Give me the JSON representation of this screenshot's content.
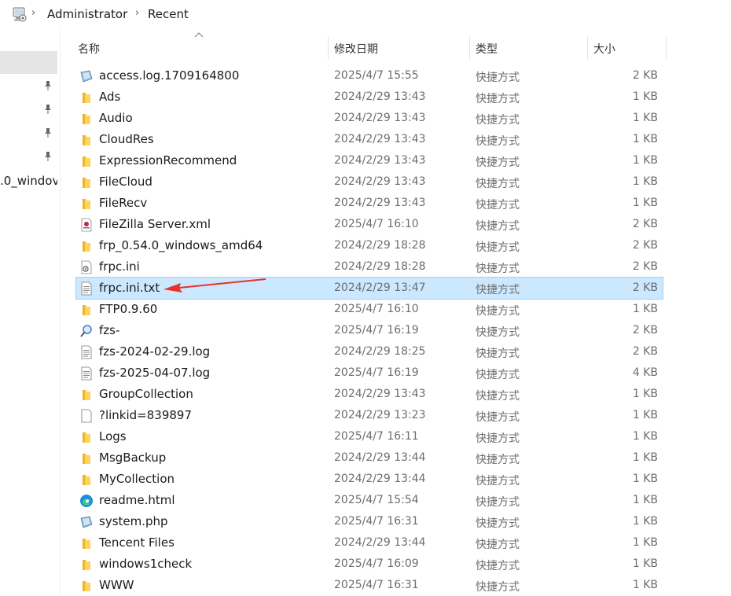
{
  "breadcrumb": {
    "items": [
      "Administrator",
      "Recent"
    ],
    "pc_icon": "computer-icon"
  },
  "nav": {
    "truncated_item": ".0_windov"
  },
  "columns": {
    "name": "名称",
    "date": "修改日期",
    "type": "类型",
    "size": "大小",
    "sort": "name-ascending"
  },
  "files": [
    {
      "name": "access.log.1709164800",
      "date": "2025/4/7 15:55",
      "type": "快捷方式",
      "size": "2 KB",
      "icon": "log-file-icon"
    },
    {
      "name": "Ads",
      "date": "2024/2/29 13:43",
      "type": "快捷方式",
      "size": "1 KB",
      "icon": "folder-icon"
    },
    {
      "name": "Audio",
      "date": "2024/2/29 13:43",
      "type": "快捷方式",
      "size": "1 KB",
      "icon": "folder-icon"
    },
    {
      "name": "CloudRes",
      "date": "2024/2/29 13:43",
      "type": "快捷方式",
      "size": "1 KB",
      "icon": "folder-icon"
    },
    {
      "name": "ExpressionRecommend",
      "date": "2024/2/29 13:43",
      "type": "快捷方式",
      "size": "1 KB",
      "icon": "folder-icon"
    },
    {
      "name": "FileCloud",
      "date": "2024/2/29 13:43",
      "type": "快捷方式",
      "size": "1 KB",
      "icon": "folder-icon"
    },
    {
      "name": "FileRecv",
      "date": "2024/2/29 13:43",
      "type": "快捷方式",
      "size": "1 KB",
      "icon": "folder-icon"
    },
    {
      "name": "FileZilla Server.xml",
      "date": "2025/4/7 16:10",
      "type": "快捷方式",
      "size": "2 KB",
      "icon": "xml-file-icon"
    },
    {
      "name": "frp_0.54.0_windows_amd64",
      "date": "2024/2/29 18:28",
      "type": "快捷方式",
      "size": "2 KB",
      "icon": "folder-icon"
    },
    {
      "name": "frpc.ini",
      "date": "2024/2/29 18:28",
      "type": "快捷方式",
      "size": "2 KB",
      "icon": "settings-file-icon"
    },
    {
      "name": "frpc.ini.txt",
      "date": "2024/2/29 13:47",
      "type": "快捷方式",
      "size": "2 KB",
      "icon": "text-file-icon",
      "selected": true
    },
    {
      "name": "FTP0.9.60",
      "date": "2025/4/7 16:10",
      "type": "快捷方式",
      "size": "1 KB",
      "icon": "folder-icon"
    },
    {
      "name": "fzs-",
      "date": "2025/4/7 16:19",
      "type": "快捷方式",
      "size": "2 KB",
      "icon": "search-icon"
    },
    {
      "name": "fzs-2024-02-29.log",
      "date": "2024/2/29 18:25",
      "type": "快捷方式",
      "size": "2 KB",
      "icon": "text-file-icon"
    },
    {
      "name": "fzs-2025-04-07.log",
      "date": "2025/4/7 16:19",
      "type": "快捷方式",
      "size": "4 KB",
      "icon": "text-file-icon"
    },
    {
      "name": "GroupCollection",
      "date": "2024/2/29 13:43",
      "type": "快捷方式",
      "size": "1 KB",
      "icon": "folder-icon"
    },
    {
      "name": "?linkid=839897",
      "date": "2024/2/29 13:23",
      "type": "快捷方式",
      "size": "1 KB",
      "icon": "blank-file-icon"
    },
    {
      "name": "Logs",
      "date": "2025/4/7 16:11",
      "type": "快捷方式",
      "size": "1 KB",
      "icon": "folder-icon"
    },
    {
      "name": "MsgBackup",
      "date": "2024/2/29 13:44",
      "type": "快捷方式",
      "size": "1 KB",
      "icon": "folder-icon"
    },
    {
      "name": "MyCollection",
      "date": "2024/2/29 13:44",
      "type": "快捷方式",
      "size": "1 KB",
      "icon": "folder-icon"
    },
    {
      "name": "readme.html",
      "date": "2025/4/7 15:54",
      "type": "快捷方式",
      "size": "1 KB",
      "icon": "edge-icon"
    },
    {
      "name": "system.php",
      "date": "2025/4/7 16:31",
      "type": "快捷方式",
      "size": "1 KB",
      "icon": "php-file-icon"
    },
    {
      "name": "Tencent Files",
      "date": "2024/2/29 13:44",
      "type": "快捷方式",
      "size": "1 KB",
      "icon": "folder-icon"
    },
    {
      "name": "windows1check",
      "date": "2025/4/7 16:09",
      "type": "快捷方式",
      "size": "1 KB",
      "icon": "folder-icon"
    },
    {
      "name": "WWW",
      "date": "2025/4/7 16:31",
      "type": "快捷方式",
      "size": "1 KB",
      "icon": "folder-icon"
    }
  ],
  "annotation": {
    "type": "red-arrow",
    "target": "frpc.ini.txt"
  },
  "colors": {
    "selected_bg": "#cce8ff",
    "selected_border": "#99d1ff",
    "folder": "#f8c33a",
    "arrow": "#e8322a"
  }
}
